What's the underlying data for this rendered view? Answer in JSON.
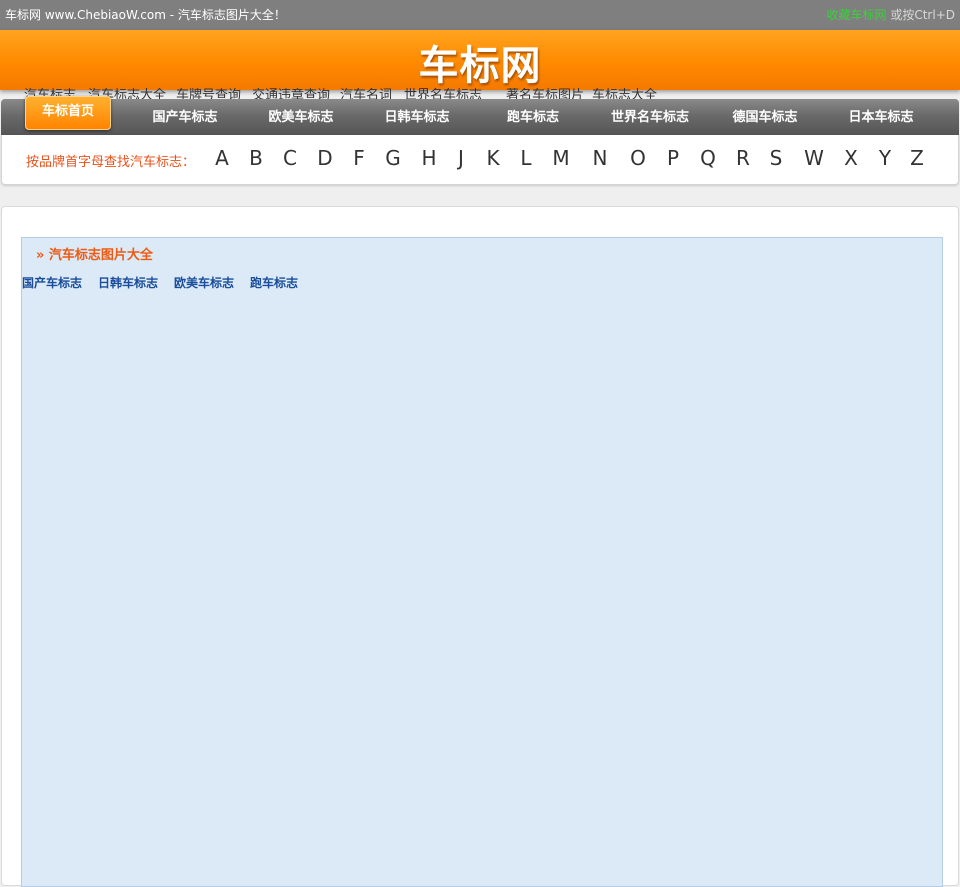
{
  "topbar": {
    "site_desc": "车标网 www.ChebiaoW.com - 汽车标志图片大全！",
    "fav_link": "收藏车标网",
    "fav_hint": "或按Ctrl+D"
  },
  "header": {
    "logo_text": "车标网"
  },
  "sublinks": [
    "汽车标志",
    "汽车标志大全",
    "车牌号查询",
    "交通违章查询",
    "汽车名词",
    "世界名车标志",
    "著名车标图片",
    "车标志大全"
  ],
  "nav": {
    "home": "车标首页",
    "items": [
      "国产车标志",
      "欧美车标志",
      "日韩车标志",
      "跑车标志",
      "世界名车标志",
      "德国车标志",
      "日本车标志"
    ]
  },
  "alphabet": {
    "label": "按品牌首字母查找汽车标志：",
    "letters": [
      "A",
      "B",
      "C",
      "D",
      "F",
      "G",
      "H",
      "J",
      "K",
      "L",
      "M",
      "N",
      "O",
      "P",
      "Q",
      "R",
      "S",
      "W",
      "X",
      "Y",
      "Z"
    ]
  },
  "content": {
    "title": "» 汽车标志图片大全",
    "categories": [
      "国产车标志",
      "日韩车标志",
      "欧美车标志",
      "跑车标志"
    ]
  }
}
